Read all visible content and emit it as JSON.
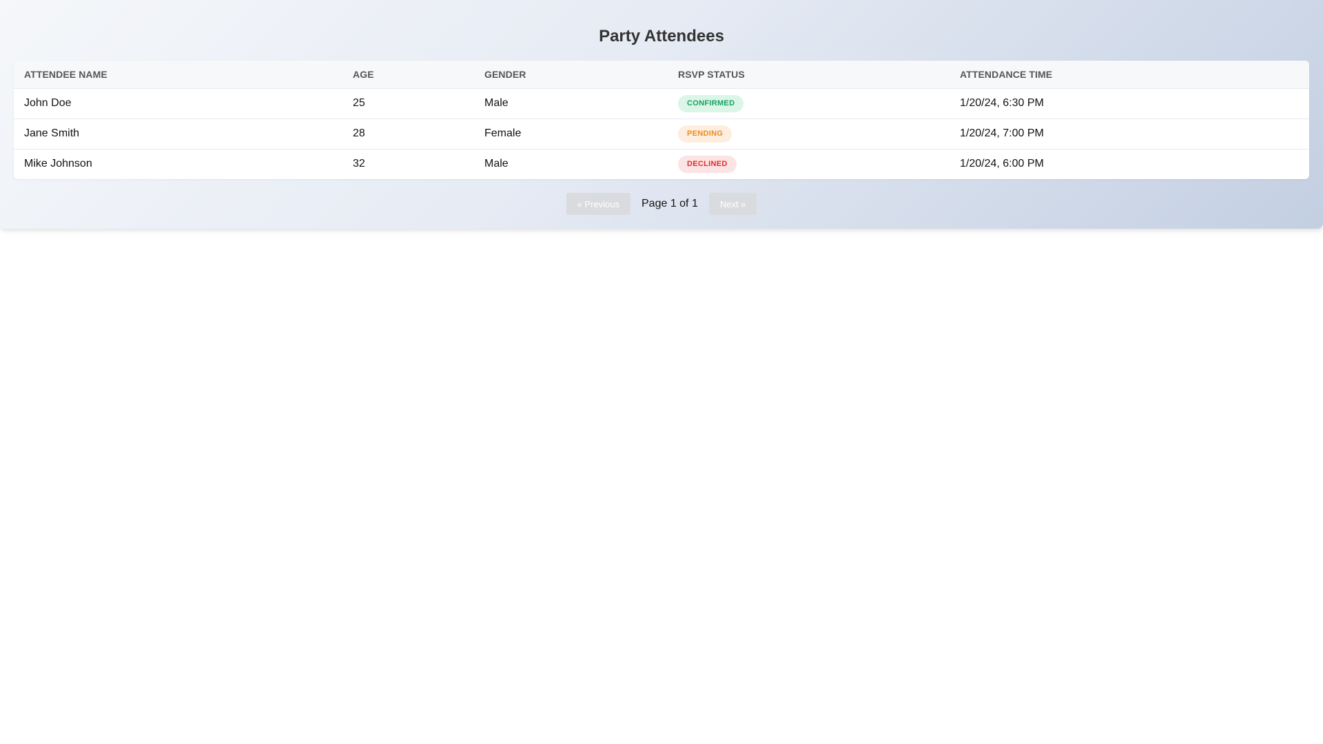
{
  "page": {
    "title": "Party Attendees"
  },
  "table": {
    "columns": [
      "Attendee Name",
      "Age",
      "Gender",
      "RSVP Status",
      "Attendance Time"
    ],
    "rows": [
      {
        "name": "John Doe",
        "age": "25",
        "gender": "Male",
        "rsvp": "Confirmed",
        "time": "1/20/24, 6:30 PM"
      },
      {
        "name": "Jane Smith",
        "age": "28",
        "gender": "Female",
        "rsvp": "Pending",
        "time": "1/20/24, 7:00 PM"
      },
      {
        "name": "Mike Johnson",
        "age": "32",
        "gender": "Male",
        "rsvp": "Declined",
        "time": "1/20/24, 6:00 PM"
      }
    ]
  },
  "pagination": {
    "previous_label": "« Previous",
    "page_info": "Page 1 of 1",
    "next_label": "Next »"
  },
  "colors": {
    "confirmed": "#17a05d",
    "pending": "#ef8b1a",
    "declined": "#e22a2a",
    "title": "#333333"
  }
}
